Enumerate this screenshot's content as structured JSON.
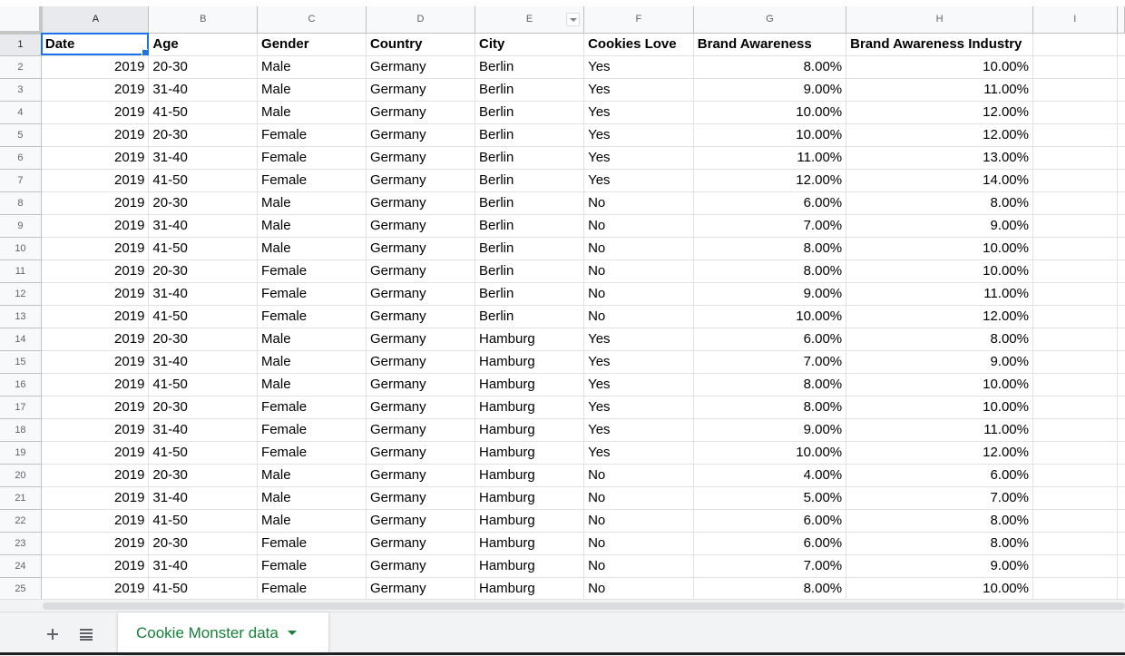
{
  "sheet": {
    "columns": [
      "A",
      "B",
      "C",
      "D",
      "E",
      "F",
      "G",
      "H",
      "I"
    ],
    "selected_column": "A",
    "selected_row": "1",
    "header_row": [
      "Date",
      "Age",
      "Gender",
      "Country",
      "City",
      "Cookies Love",
      "Brand Awareness",
      "Brand Awareness Industry"
    ],
    "rows": [
      [
        "2019",
        "20-30",
        "Male",
        "Germany",
        "Berlin",
        "Yes",
        "8.00%",
        "10.00%"
      ],
      [
        "2019",
        "31-40",
        "Male",
        "Germany",
        "Berlin",
        "Yes",
        "9.00%",
        "11.00%"
      ],
      [
        "2019",
        "41-50",
        "Male",
        "Germany",
        "Berlin",
        "Yes",
        "10.00%",
        "12.00%"
      ],
      [
        "2019",
        "20-30",
        "Female",
        "Germany",
        "Berlin",
        "Yes",
        "10.00%",
        "12.00%"
      ],
      [
        "2019",
        "31-40",
        "Female",
        "Germany",
        "Berlin",
        "Yes",
        "11.00%",
        "13.00%"
      ],
      [
        "2019",
        "41-50",
        "Female",
        "Germany",
        "Berlin",
        "Yes",
        "12.00%",
        "14.00%"
      ],
      [
        "2019",
        "20-30",
        "Male",
        "Germany",
        "Berlin",
        "No",
        "6.00%",
        "8.00%"
      ],
      [
        "2019",
        "31-40",
        "Male",
        "Germany",
        "Berlin",
        "No",
        "7.00%",
        "9.00%"
      ],
      [
        "2019",
        "41-50",
        "Male",
        "Germany",
        "Berlin",
        "No",
        "8.00%",
        "10.00%"
      ],
      [
        "2019",
        "20-30",
        "Female",
        "Germany",
        "Berlin",
        "No",
        "8.00%",
        "10.00%"
      ],
      [
        "2019",
        "31-40",
        "Female",
        "Germany",
        "Berlin",
        "No",
        "9.00%",
        "11.00%"
      ],
      [
        "2019",
        "41-50",
        "Female",
        "Germany",
        "Berlin",
        "No",
        "10.00%",
        "12.00%"
      ],
      [
        "2019",
        "20-30",
        "Male",
        "Germany",
        "Hamburg",
        "Yes",
        "6.00%",
        "8.00%"
      ],
      [
        "2019",
        "31-40",
        "Male",
        "Germany",
        "Hamburg",
        "Yes",
        "7.00%",
        "9.00%"
      ],
      [
        "2019",
        "41-50",
        "Male",
        "Germany",
        "Hamburg",
        "Yes",
        "8.00%",
        "10.00%"
      ],
      [
        "2019",
        "20-30",
        "Female",
        "Germany",
        "Hamburg",
        "Yes",
        "8.00%",
        "10.00%"
      ],
      [
        "2019",
        "31-40",
        "Female",
        "Germany",
        "Hamburg",
        "Yes",
        "9.00%",
        "11.00%"
      ],
      [
        "2019",
        "41-50",
        "Female",
        "Germany",
        "Hamburg",
        "Yes",
        "10.00%",
        "12.00%"
      ],
      [
        "2019",
        "20-30",
        "Male",
        "Germany",
        "Hamburg",
        "No",
        "4.00%",
        "6.00%"
      ],
      [
        "2019",
        "31-40",
        "Male",
        "Germany",
        "Hamburg",
        "No",
        "5.00%",
        "7.00%"
      ],
      [
        "2019",
        "41-50",
        "Male",
        "Germany",
        "Hamburg",
        "No",
        "6.00%",
        "8.00%"
      ],
      [
        "2019",
        "20-30",
        "Female",
        "Germany",
        "Hamburg",
        "No",
        "6.00%",
        "8.00%"
      ],
      [
        "2019",
        "31-40",
        "Female",
        "Germany",
        "Hamburg",
        "No",
        "7.00%",
        "9.00%"
      ],
      [
        "2019",
        "41-50",
        "Female",
        "Germany",
        "Hamburg",
        "No",
        "8.00%",
        "10.00%"
      ]
    ],
    "numeric_columns": [
      0,
      6,
      7
    ],
    "filter_column": "E"
  },
  "tabbar": {
    "add_sheet_icon": "plus-icon",
    "all_sheets_icon": "list-icon",
    "active_tab_label": "Cookie Monster data",
    "active_tab_color": "#188038"
  },
  "colors": {
    "selection": "#1a73e8",
    "header_bg": "#f8f9fa",
    "selected_header_bg": "#e8eaed"
  }
}
